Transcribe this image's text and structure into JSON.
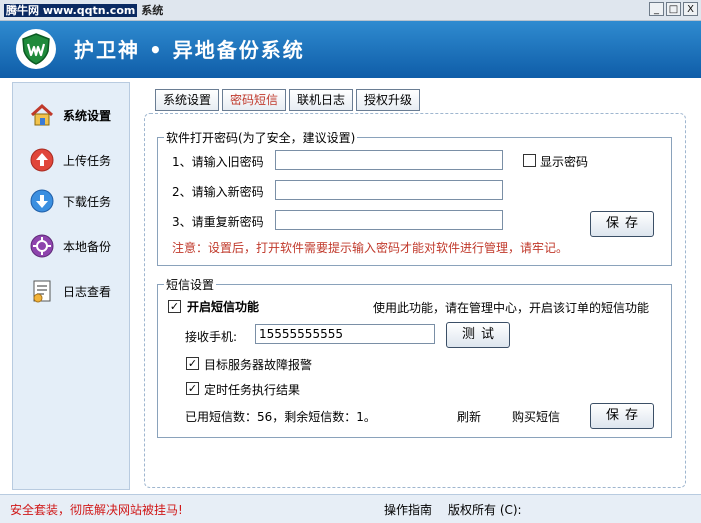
{
  "window": {
    "watermark": "腾牛网 www.qqtn.com",
    "title_suffix": "系统",
    "btn_min": "_",
    "btn_max": "□",
    "btn_close": "X"
  },
  "app": {
    "title": "护卫神 • 异地备份系统"
  },
  "sidebar": {
    "items": [
      {
        "label": "系统设置",
        "icon": "home-icon"
      },
      {
        "label": "上传任务",
        "icon": "upload-icon"
      },
      {
        "label": "下载任务",
        "icon": "download-icon"
      },
      {
        "label": "本地备份",
        "icon": "local-backup-icon"
      },
      {
        "label": "日志查看",
        "icon": "log-icon"
      }
    ]
  },
  "tabs": [
    {
      "label": "系统设置"
    },
    {
      "label": "密码短信"
    },
    {
      "label": "联机日志"
    },
    {
      "label": "授权升级"
    }
  ],
  "password_section": {
    "legend": "软件打开密码(为了安全，建议设置)",
    "old_label": "1、请输入旧密码",
    "new_label": "2、请输入新密码",
    "repeat_label": "3、请重复新密码",
    "old_value": "",
    "new_value": "",
    "repeat_value": "",
    "show_password_label": "显示密码",
    "show_password_checked": false,
    "save_label": "保存",
    "note": "注意：设置后，打开软件需要提示输入密码才能对软件进行管理，请牢记。"
  },
  "sms_section": {
    "legend": "短信设置",
    "enable_label": "开启短信功能",
    "enable_checked": true,
    "enable_hint": "使用此功能，请在管理中心，开启该订单的短信功能",
    "phone_label": "接收手机:",
    "phone_value": "15555555555",
    "test_label": "测试",
    "alarm_label": "目标服务器故障报警",
    "alarm_checked": true,
    "result_label": "定时任务执行结果",
    "result_checked": true,
    "usage_text": "已用短信数：56，剩余短信数：1。",
    "refresh_label": "刷新",
    "buy_label": "购买短信",
    "save_label": "保存"
  },
  "statusbar": {
    "warning": "安全套装，彻底解决网站被挂马!",
    "guide": "操作指南",
    "copyright": "版权所有 (C):"
  },
  "colors": {
    "header_top": "#2f8bd0",
    "header_bottom": "#0f5da8",
    "accent_red": "#c0392b"
  }
}
